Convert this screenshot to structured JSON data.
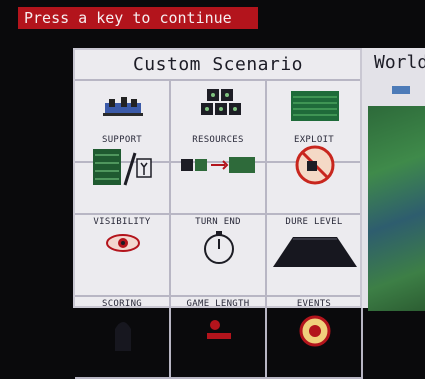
{
  "prompt": "Press a key to continue",
  "panel": {
    "title": "Custom Scenario",
    "cells": [
      {
        "label": "",
        "icon": "support-units-icon"
      },
      {
        "label": "",
        "icon": "resources-crates-icon"
      },
      {
        "label": "",
        "icon": "exploit-field-icon"
      },
      {
        "label": "SUPPORT",
        "icon": "support-vs-soldier-icon"
      },
      {
        "label": "RESOURCES",
        "icon": "resource-transfer-icon"
      },
      {
        "label": "EXPLOIT",
        "icon": "exploit-forbidden-icon"
      },
      {
        "label": "VISIBILITY",
        "icon": "eye-icon"
      },
      {
        "label": "TURN END",
        "icon": "stopwatch-icon"
      },
      {
        "label": "DURE LEVEL",
        "icon": "hill-icon"
      },
      {
        "label": "SCORING",
        "icon": "figure-icon"
      },
      {
        "label": "GAME LENGTH",
        "icon": "game-length-icon"
      },
      {
        "label": "EVENTS",
        "icon": "events-icon"
      }
    ]
  },
  "world": {
    "title": "World"
  },
  "colors": {
    "prompt_bg": "#b3141c",
    "panel_bg": "#ecebef",
    "screen_bg": "#0a0a0c"
  }
}
